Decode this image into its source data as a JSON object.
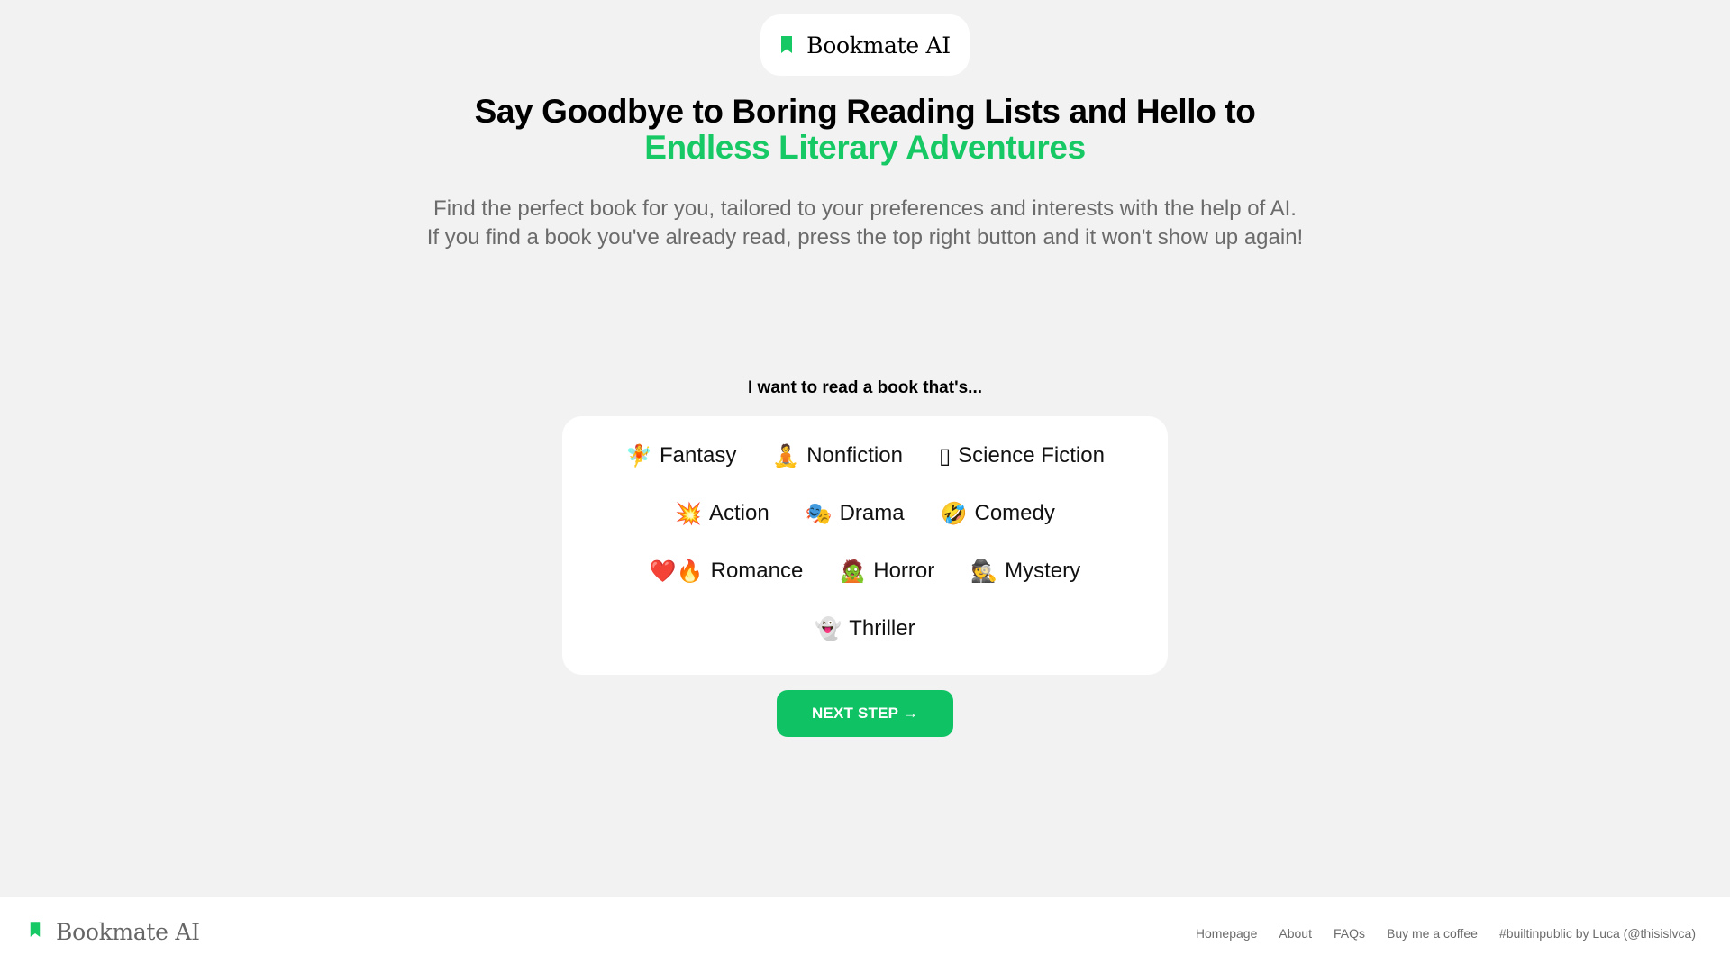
{
  "brand": {
    "name": "Bookmate AI",
    "accent_color": "#16c964",
    "icon": "bookmark-icon"
  },
  "hero": {
    "headline_plain": "Say Goodbye to Boring Reading Lists and Hello to ",
    "headline_accent": "Endless Literary Adventures",
    "subtitle_line1": "Find the perfect book for you, tailored to your preferences and interests with the help of AI.",
    "subtitle_line2": "If you find a book you've already read, press the top right button and it won't show up again!"
  },
  "form": {
    "question": "I want to read a book that's...",
    "genres": [
      [
        {
          "emoji": "🧚",
          "label": "Fantasy"
        },
        {
          "emoji": "🧘",
          "label": "Nonfiction"
        },
        {
          "emoji": "▯",
          "label": "Science Fiction"
        }
      ],
      [
        {
          "emoji": "💥",
          "label": "Action"
        },
        {
          "emoji": "🎭",
          "label": "Drama"
        },
        {
          "emoji": "🤣",
          "label": "Comedy"
        }
      ],
      [
        {
          "emoji": "❤️🔥",
          "label": "Romance"
        },
        {
          "emoji": "🧟",
          "label": "Horror"
        },
        {
          "emoji": "🕵",
          "label": "Mystery"
        }
      ],
      [
        {
          "emoji": "👻",
          "label": "Thriller"
        }
      ]
    ],
    "next_label": "NEXT STEP →",
    "button_color": "#0fc364"
  },
  "footer": {
    "brand_name": "Bookmate AI",
    "links": [
      "Homepage",
      "About",
      "FAQs",
      "Buy me a coffee",
      "#builtinpublic by Luca (@thisislvca)"
    ]
  }
}
